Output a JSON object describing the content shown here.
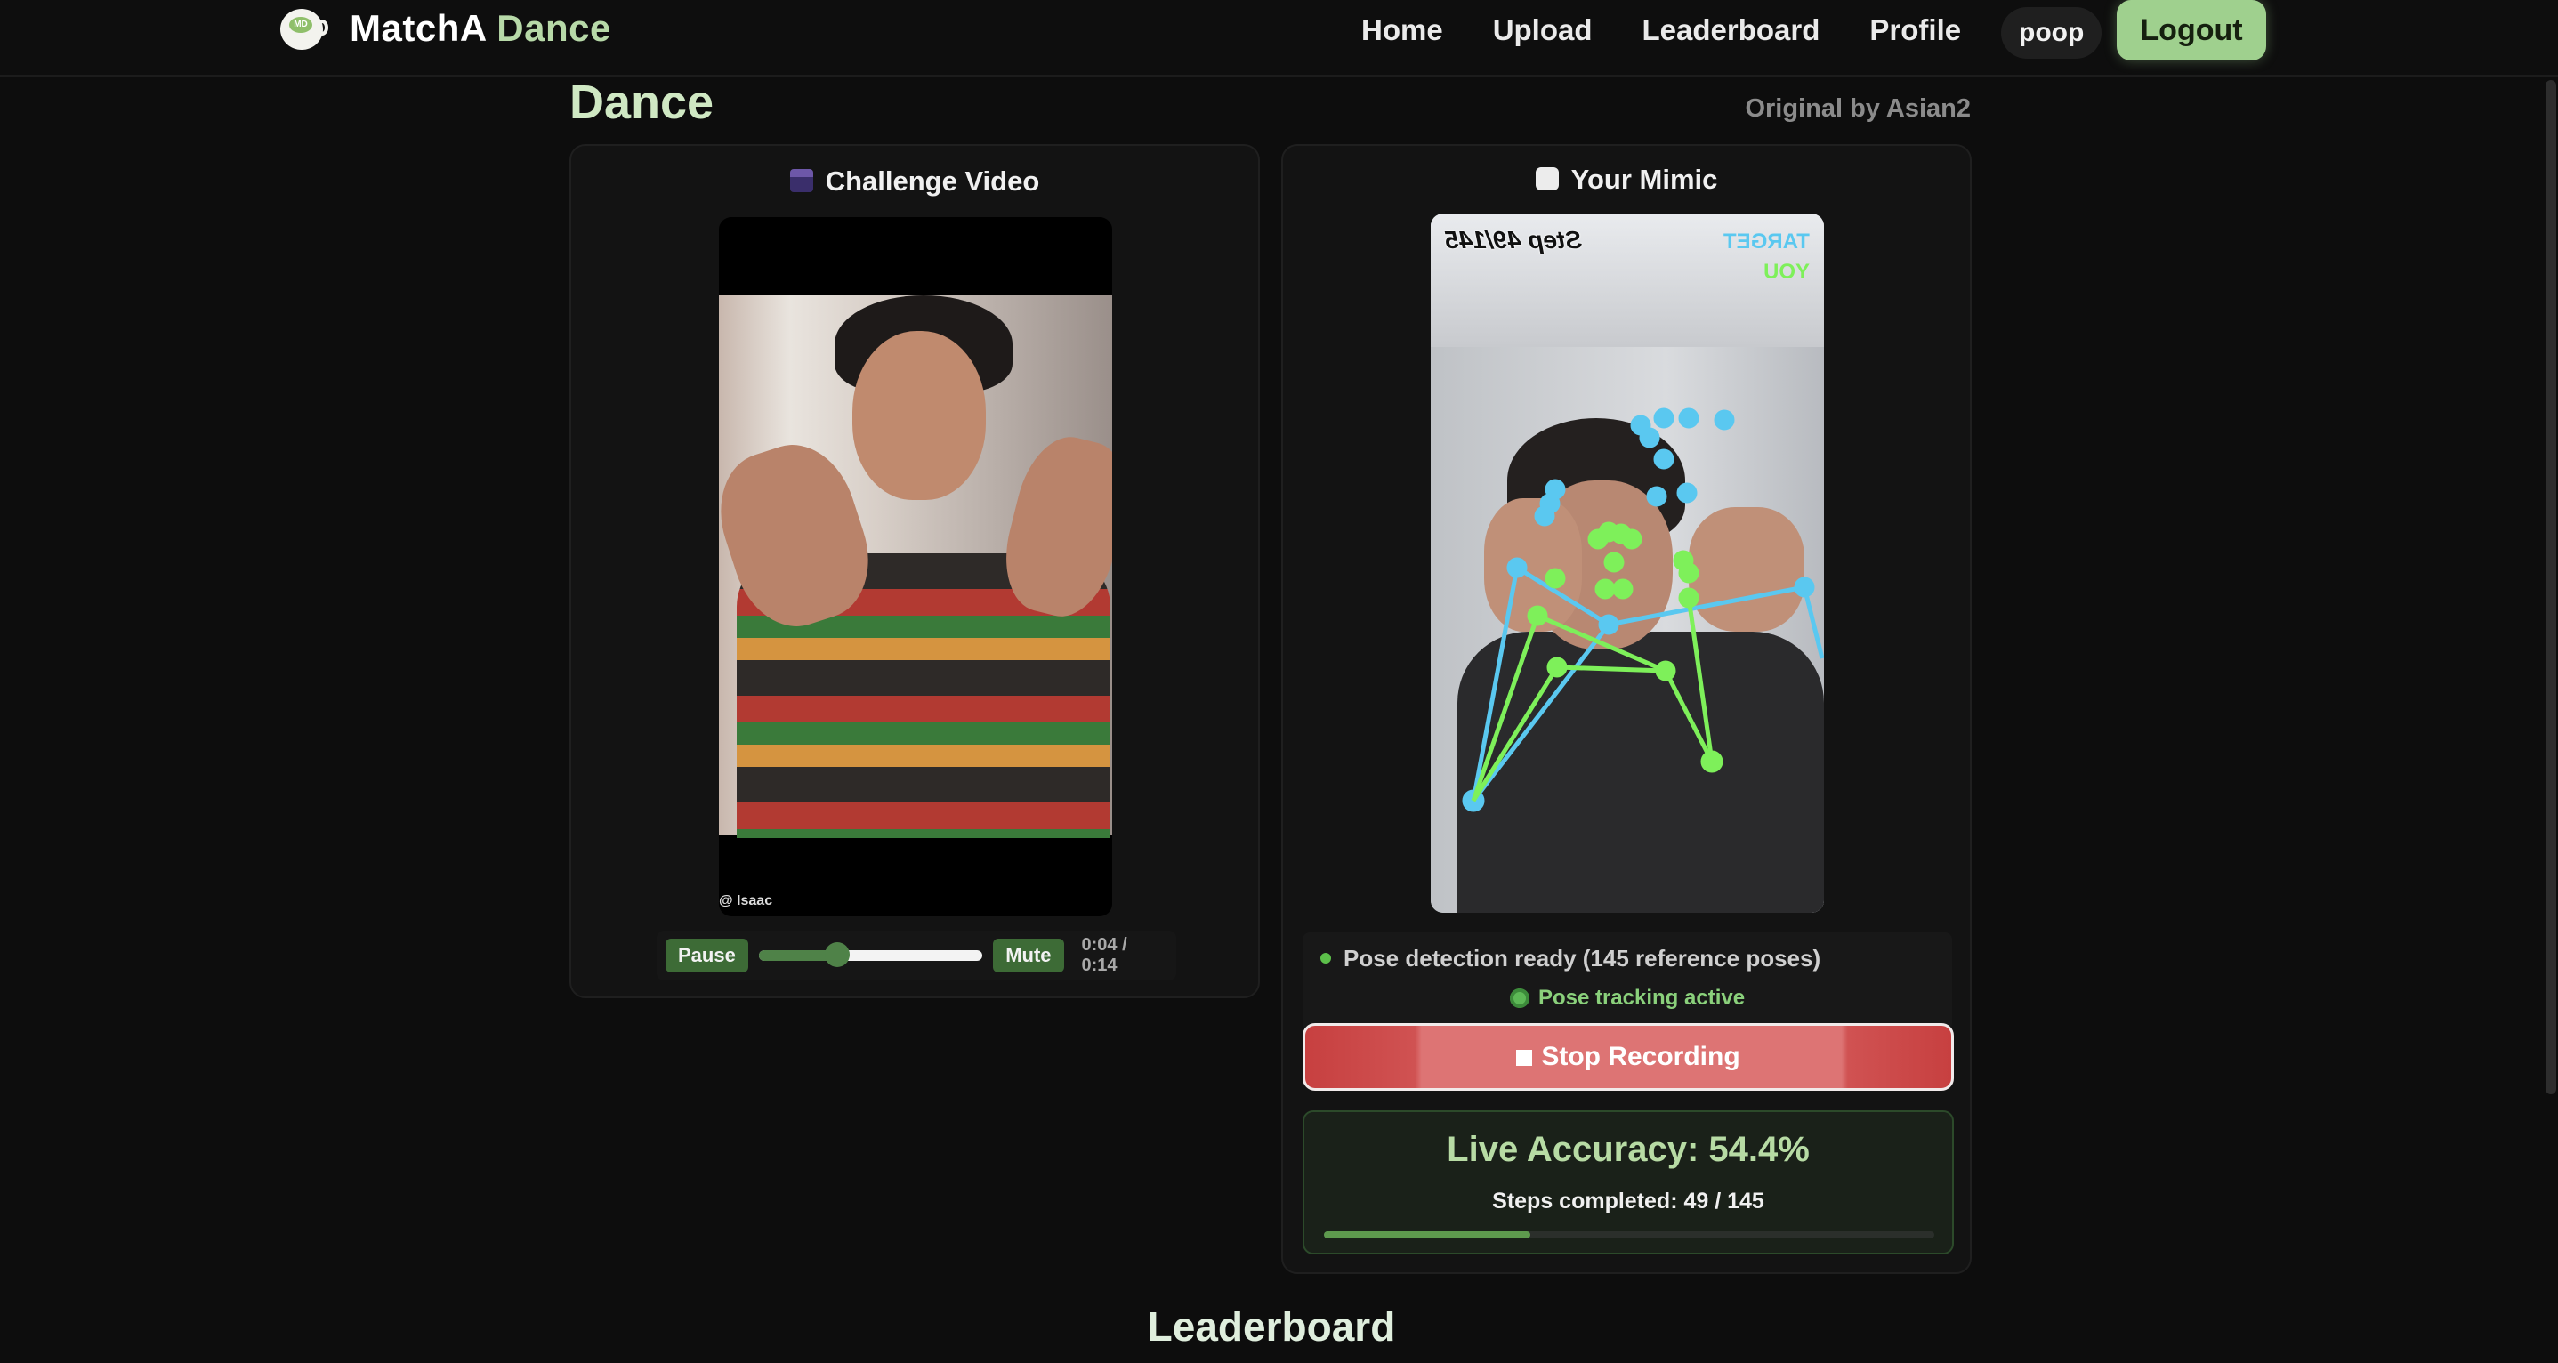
{
  "brand": {
    "name_part1": "MatchA",
    "name_part2": "Dance",
    "logo_text": "MD"
  },
  "nav": {
    "links": [
      "Home",
      "Upload",
      "Leaderboard",
      "Profile"
    ],
    "user": "poop",
    "logout": "Logout"
  },
  "page": {
    "title": "Dance",
    "original_by": "Original by Asian2"
  },
  "challenge": {
    "heading": "Challenge Video",
    "icon": "clapperboard-icon",
    "watermark": "@ Isaac",
    "controls": {
      "pause_label": "Pause",
      "mute_label": "Mute",
      "time": "0:04 / 0:14",
      "progress": 0.35
    }
  },
  "mimic": {
    "heading": "Your Mimic",
    "icon": "camera-icon",
    "overlay_step": "Step 49/145",
    "overlay_target": "TARGET",
    "overlay_you": "YOU",
    "target_color": "#5ac8f0",
    "you_color": "#7ef05a",
    "status_ready": "Pose detection ready (145 reference poses)",
    "status_tracking": "Pose tracking active",
    "stop_label": "Stop Recording",
    "accuracy_title": "Live Accuracy: 54.4%",
    "steps_text": "Steps completed: 49 / 145",
    "steps_fraction": 0.338
  },
  "leaderboard": {
    "heading": "Leaderboard"
  },
  "colors": {
    "accent": "#9fd08e",
    "stop_red": "#c74040",
    "background": "#0d0d0d"
  }
}
